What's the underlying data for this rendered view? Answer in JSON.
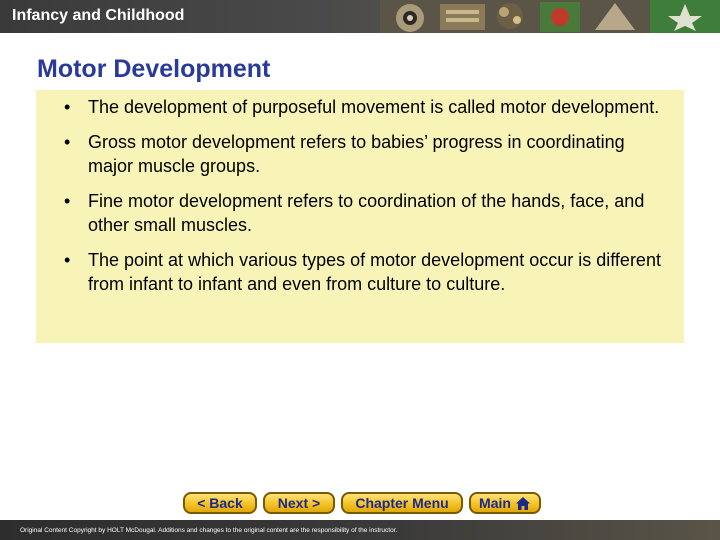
{
  "header": {
    "title": "Infancy and Childhood"
  },
  "slide": {
    "title": "Motor Development",
    "bullets": [
      "The development of purposeful movement is called motor development.",
      "Gross motor development refers to babies’ progress in coordinating major muscle groups.",
      "Fine motor development refers to coordination of the hands, face, and other small muscles.",
      "The point at which various types of motor development occur is different from infant to infant and even from culture to culture."
    ]
  },
  "nav": {
    "back": "< Back",
    "next": "Next >",
    "chapter_menu": "Chapter Menu",
    "main": "Main",
    "main_icon": "home-icon"
  },
  "footer": {
    "copyright": "Original Content Copyright by HOLT McDougal. Additions and changes to the original content are the responsibility of the instructor."
  },
  "colors": {
    "title": "#2a3a9a",
    "content_background": "#f8f4b8",
    "button_fill": "#f5c225",
    "button_text": "#1c2a8c",
    "header_bar": "#3a3a3a"
  }
}
